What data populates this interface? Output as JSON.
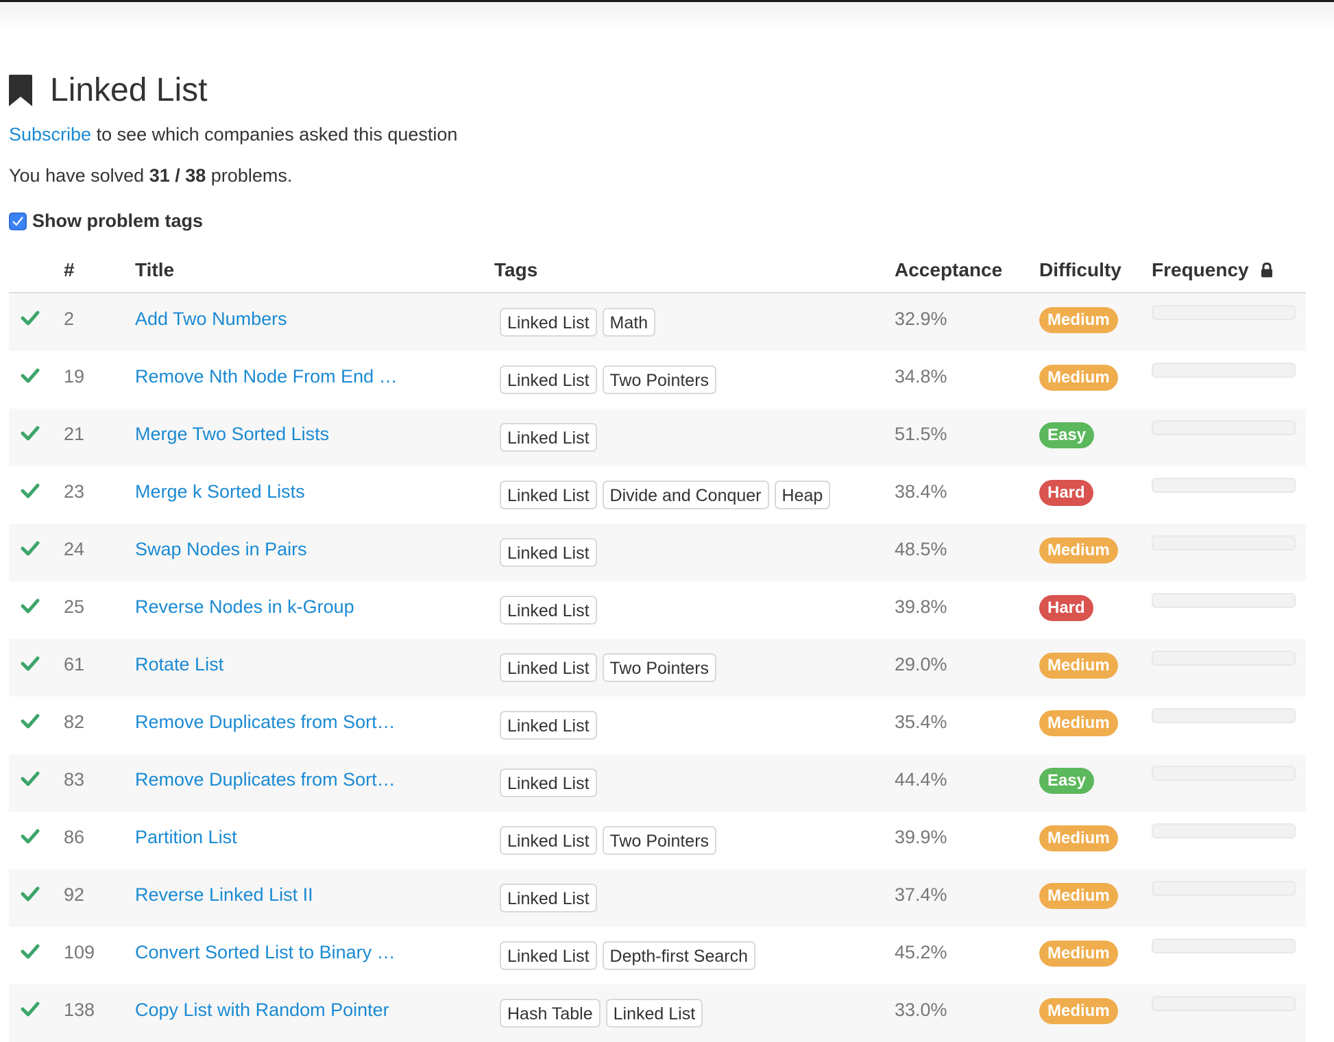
{
  "page": {
    "title": "Linked List",
    "subscribe_link": "Subscribe",
    "subscribe_rest": "to see which companies asked this question",
    "solved_prefix": "You have solved",
    "solved_count": "31 / 38",
    "solved_suffix": "problems.",
    "show_tags_label": "Show problem tags",
    "show_tags_checked": true
  },
  "table": {
    "headers": {
      "num": "#",
      "title": "Title",
      "tags": "Tags",
      "acceptance": "Acceptance",
      "difficulty": "Difficulty",
      "frequency": "Frequency"
    },
    "difficulty_colors": {
      "Medium": "#f0ad4e",
      "Easy": "#5cb85c",
      "Hard": "#d9534f"
    },
    "status_color": "#3ca56a",
    "link_color": "#1a8ad3",
    "rows": [
      {
        "num": "2",
        "title": "Add Two Numbers",
        "tags": [
          "Linked List",
          "Math"
        ],
        "acceptance": "32.9%",
        "difficulty": "Medium",
        "solved": true
      },
      {
        "num": "19",
        "title": "Remove Nth Node From End …",
        "tags": [
          "Linked List",
          "Two Pointers"
        ],
        "acceptance": "34.8%",
        "difficulty": "Medium",
        "solved": true
      },
      {
        "num": "21",
        "title": "Merge Two Sorted Lists",
        "tags": [
          "Linked List"
        ],
        "acceptance": "51.5%",
        "difficulty": "Easy",
        "solved": true
      },
      {
        "num": "23",
        "title": "Merge k Sorted Lists",
        "tags": [
          "Linked List",
          "Divide and Conquer",
          "Heap"
        ],
        "acceptance": "38.4%",
        "difficulty": "Hard",
        "solved": true
      },
      {
        "num": "24",
        "title": "Swap Nodes in Pairs",
        "tags": [
          "Linked List"
        ],
        "acceptance": "48.5%",
        "difficulty": "Medium",
        "solved": true
      },
      {
        "num": "25",
        "title": "Reverse Nodes in k-Group",
        "tags": [
          "Linked List"
        ],
        "acceptance": "39.8%",
        "difficulty": "Hard",
        "solved": true
      },
      {
        "num": "61",
        "title": "Rotate List",
        "tags": [
          "Linked List",
          "Two Pointers"
        ],
        "acceptance": "29.0%",
        "difficulty": "Medium",
        "solved": true
      },
      {
        "num": "82",
        "title": "Remove Duplicates from Sort…",
        "tags": [
          "Linked List"
        ],
        "acceptance": "35.4%",
        "difficulty": "Medium",
        "solved": true
      },
      {
        "num": "83",
        "title": "Remove Duplicates from Sort…",
        "tags": [
          "Linked List"
        ],
        "acceptance": "44.4%",
        "difficulty": "Easy",
        "solved": true
      },
      {
        "num": "86",
        "title": "Partition List",
        "tags": [
          "Linked List",
          "Two Pointers"
        ],
        "acceptance": "39.9%",
        "difficulty": "Medium",
        "solved": true
      },
      {
        "num": "92",
        "title": "Reverse Linked List II",
        "tags": [
          "Linked List"
        ],
        "acceptance": "37.4%",
        "difficulty": "Medium",
        "solved": true
      },
      {
        "num": "109",
        "title": "Convert Sorted List to Binary …",
        "tags": [
          "Linked List",
          "Depth-first Search"
        ],
        "acceptance": "45.2%",
        "difficulty": "Medium",
        "solved": true
      },
      {
        "num": "138",
        "title": "Copy List with Random Pointer",
        "tags": [
          "Hash Table",
          "Linked List"
        ],
        "acceptance": "33.0%",
        "difficulty": "Medium",
        "solved": true
      }
    ]
  },
  "icons": {
    "heading": "bookmark-icon",
    "status": "check-icon",
    "frequency": "lock-icon"
  }
}
